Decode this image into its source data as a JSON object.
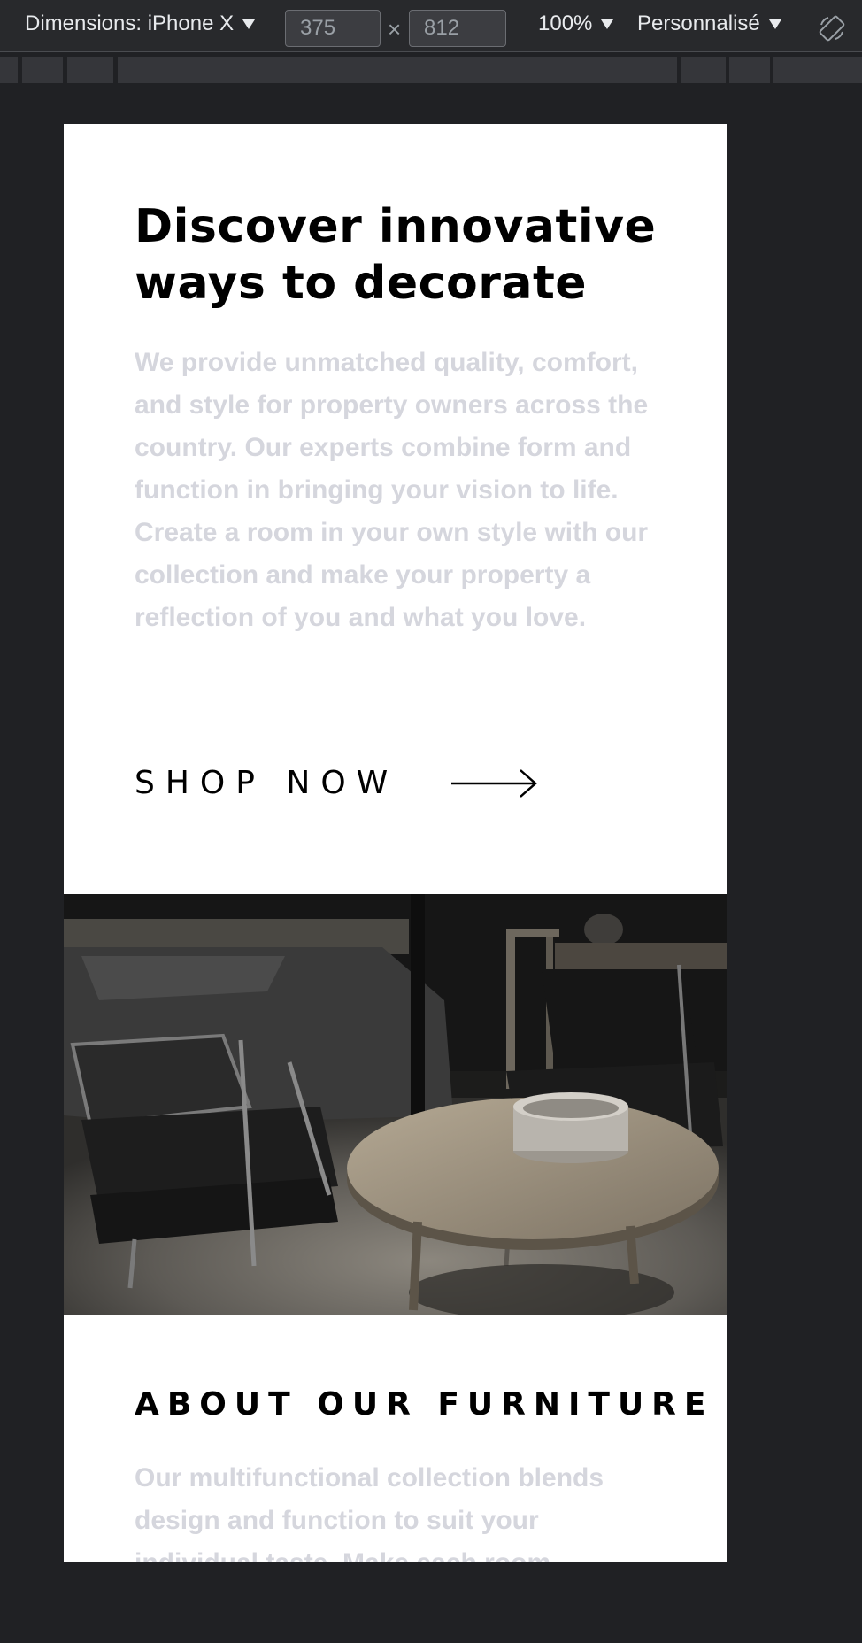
{
  "devtools": {
    "device_label": "Dimensions: iPhone X",
    "width_value": "375",
    "height_value": "812",
    "times_symbol": "×",
    "zoom_label": "100%",
    "throttle_label": "Personnalisé"
  },
  "hero": {
    "title": "Discover innovative ways to decorate",
    "text": "We provide unmatched quality, comfort, and style for property owners across the country. Our experts combine form and function in bringing your vision to life. Create a room in your own style with our collection and make your property a reflection of you and what you love.",
    "cta_label": "SHOP NOW"
  },
  "about": {
    "title": "ABOUT OUR FURNITURE",
    "text": "Our multifunctional collection blends design and function to suit your individual taste. Make each room"
  },
  "colors": {
    "page_bg": "#202124",
    "toolbar_bg": "#28292c",
    "card_bg": "#ffffff",
    "heading": "#000000",
    "body_text": "#d5d6dd"
  },
  "icons": [
    "chevron-down-icon",
    "rotate-device-icon",
    "arrow-right-icon"
  ]
}
